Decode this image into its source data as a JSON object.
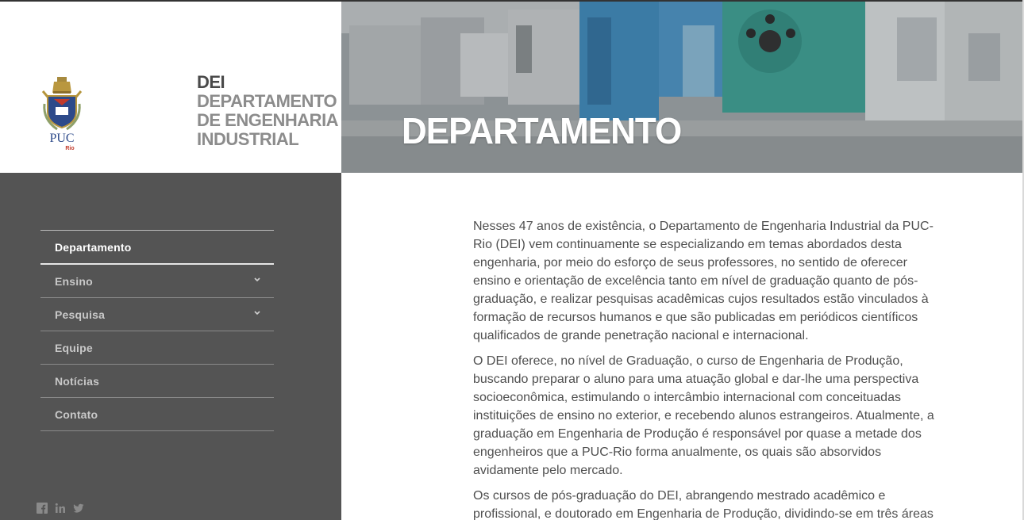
{
  "logo": {
    "crest_text": "PUC",
    "crest_subtext": "Rio",
    "dept_abbrev": "DEI",
    "dept_lines": [
      "DEPARTAMENTO",
      "DE ENGENHARIA",
      "INDUSTRIAL"
    ]
  },
  "hero": {
    "title": "DEPARTAMENTO"
  },
  "nav": {
    "items": [
      {
        "label": "Departamento",
        "active": true,
        "has_submenu": false
      },
      {
        "label": "Ensino",
        "active": false,
        "has_submenu": true
      },
      {
        "label": "Pesquisa",
        "active": false,
        "has_submenu": true
      },
      {
        "label": "Equipe",
        "active": false,
        "has_submenu": false
      },
      {
        "label": "Notícias",
        "active": false,
        "has_submenu": false
      },
      {
        "label": "Contato",
        "active": false,
        "has_submenu": false
      }
    ]
  },
  "social": [
    "facebook-icon",
    "linkedin-icon",
    "twitter-icon"
  ],
  "content": {
    "paragraphs": [
      "Nesses 47 anos de existência, o Departamento de Engenharia Industrial da PUC-Rio (DEI) vem continuamente se especializando em temas abordados desta engenharia, por meio do esforço de seus professores, no sentido de oferecer ensino e orientação de excelência tanto em nível de graduação quanto de pós-graduação, e realizar pesquisas acadêmicas cujos resultados estão vinculados à formação de recursos humanos e que são publicadas em periódicos científicos qualificados de grande penetração nacional e internacional.",
      "O DEI oferece, no nível de Graduação, o curso de Engenharia de Produção, buscando preparar o aluno para uma atuação global e dar-lhe uma perspectiva socioeconômica, estimulando o intercâmbio internacional com conceituadas instituições de ensino no exterior, e recebendo alunos estrangeiros. Atualmente, a graduação em Engenharia de Produção é responsável por quase a metade dos engenheiros que a PUC-Rio forma anualmente, os quais são absorvidos avidamente pelo mercado.",
      "Os cursos de pós-graduação do DEI, abrangendo mestrado acadêmico e profissional, e doutorado em Engenharia de Produção, dividindo-se em três áreas"
    ]
  },
  "colors": {
    "sidebar_bg": "#545454",
    "text": "#4f4f4f",
    "dept_gray": "#8c8c8c"
  }
}
